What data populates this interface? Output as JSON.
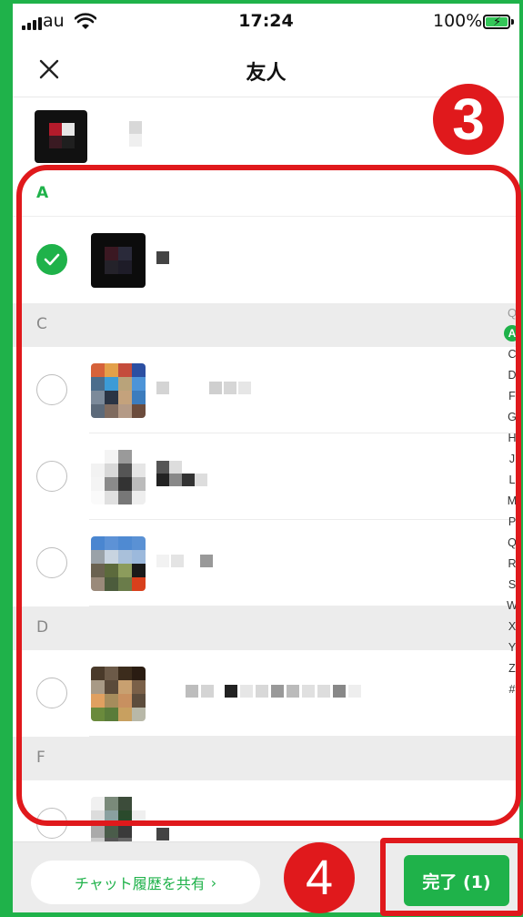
{
  "status_bar": {
    "carrier": "au",
    "time": "17:24",
    "battery": "100%"
  },
  "nav": {
    "title": "友人",
    "close_icon": "close-icon"
  },
  "selected_strip": {
    "avatar": "selected-friend-avatar"
  },
  "sections": [
    {
      "letter": "A"
    },
    {
      "letter": "C"
    },
    {
      "letter": "D"
    },
    {
      "letter": "F"
    }
  ],
  "friends": [
    {
      "section": "A",
      "selected": true
    },
    {
      "section": "C",
      "selected": false
    },
    {
      "section": "C",
      "selected": false
    },
    {
      "section": "C",
      "selected": false
    },
    {
      "section": "D",
      "selected": false
    },
    {
      "section": "F",
      "selected": false
    }
  ],
  "index_bar": [
    "Q",
    "A",
    "C",
    "D",
    "F",
    "G",
    "H",
    "J",
    "L",
    "M",
    "P",
    "Q",
    "R",
    "S",
    "W",
    "X",
    "Y",
    "Z",
    "#"
  ],
  "bottom_bar": {
    "share_label": "チャット履歴を共有",
    "share_chevron": "›",
    "done_label": "完了 (1)"
  },
  "annotations": {
    "step3": "3",
    "step4": "4"
  },
  "colors": {
    "accent": "#1fb24a",
    "annotation_red": "#e0191c"
  }
}
